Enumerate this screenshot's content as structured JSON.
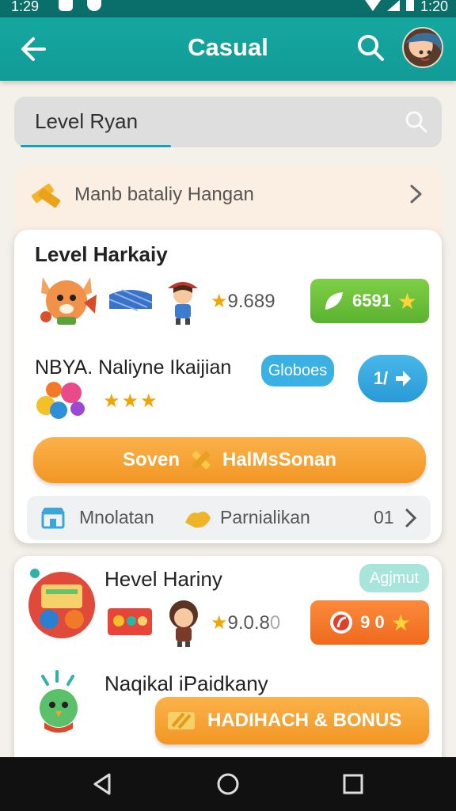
{
  "status_bar": {
    "time_left": "1:29",
    "time_right": "1:20"
  },
  "app_bar": {
    "title": "Casual",
    "back_icon": "arrow-left-icon",
    "search_icon": "search-icon",
    "avatar": "profile-avatar"
  },
  "search": {
    "value": "Level Ryan",
    "icon": "search-icon"
  },
  "promo": {
    "text": "Manb bataliy Hangan",
    "icon": "gold-bars-icon",
    "chevron": "chevron-right-icon"
  },
  "card1": {
    "row1": {
      "title": "Level   Harkaiy",
      "rating": "9.689",
      "button_label": "6591"
    },
    "row2": {
      "title": "NBYA.  Naliyne Ikaijian",
      "tag": "Globoes",
      "button_label": "1/",
      "stars": 3
    },
    "cta": {
      "left": "Soven",
      "right": "HalMsSonan"
    },
    "footer": {
      "left_label": "Mnolatan",
      "right_label": "Parnialikan",
      "count": "01"
    }
  },
  "card2": {
    "row1": {
      "title": "Hevel  Hariny",
      "tag": "Agjmut",
      "rating": "9.0.8",
      "rating_last": "0",
      "button_label": "9 0"
    },
    "row2": {
      "title": "Naqikal iPaidkany",
      "cta": "HADIHACH & BONUS"
    }
  },
  "nav": {
    "back": "back-triangle-icon",
    "home": "home-circle-icon",
    "recents": "recents-square-icon"
  },
  "colors": {
    "teal": "#16a7a1",
    "orange": "#f29624",
    "green": "#6cbf3b",
    "blue": "#3bb0e2",
    "red_orange": "#f07a2a"
  }
}
